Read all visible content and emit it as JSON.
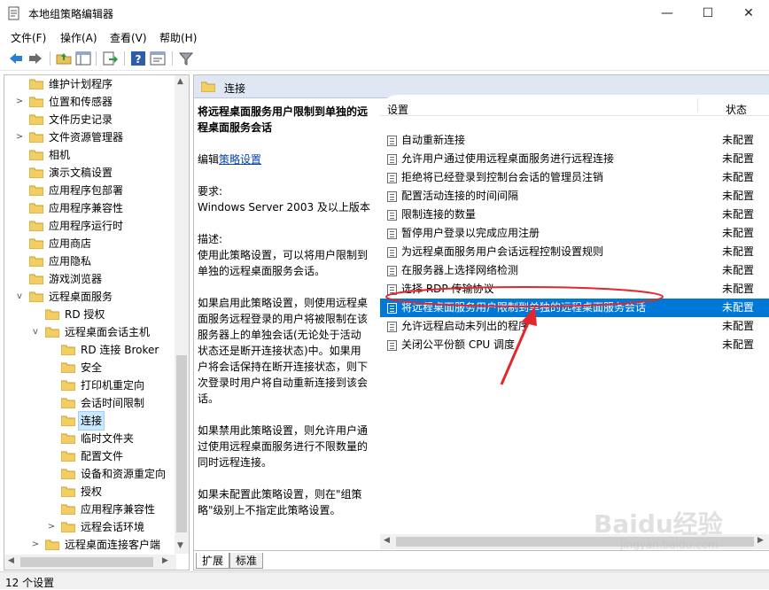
{
  "window": {
    "title": "本地组策略编辑器",
    "controls": {
      "minimize": "—",
      "maximize": "☐",
      "close": "✕"
    }
  },
  "menu": [
    "文件(F)",
    "操作(A)",
    "查看(V)",
    "帮助(H)"
  ],
  "toolbar_icons": [
    "back-icon",
    "forward-icon",
    "up-folder-icon",
    "show-hide-tree-icon",
    "export-icon",
    "help-icon",
    "properties-icon",
    "filter-icon"
  ],
  "tree": [
    {
      "label": "维护计划程序",
      "expander": ""
    },
    {
      "label": "位置和传感器",
      "expander": ">"
    },
    {
      "label": "文件历史记录",
      "expander": ""
    },
    {
      "label": "文件资源管理器",
      "expander": ">"
    },
    {
      "label": "相机",
      "expander": ""
    },
    {
      "label": "演示文稿设置",
      "expander": ""
    },
    {
      "label": "应用程序包部署",
      "expander": ""
    },
    {
      "label": "应用程序兼容性",
      "expander": ""
    },
    {
      "label": "应用程序运行时",
      "expander": ""
    },
    {
      "label": "应用商店",
      "expander": ""
    },
    {
      "label": "应用隐私",
      "expander": ""
    },
    {
      "label": "游戏浏览器",
      "expander": ""
    },
    {
      "label": "远程桌面服务",
      "expander": "v"
    },
    {
      "label": "RD 授权",
      "expander": ""
    },
    {
      "label": "远程桌面会话主机",
      "expander": "v"
    },
    {
      "label": "RD 连接 Broker",
      "expander": ""
    },
    {
      "label": "安全",
      "expander": ""
    },
    {
      "label": "打印机重定向",
      "expander": ""
    },
    {
      "label": "会话时间限制",
      "expander": ""
    },
    {
      "label": "连接",
      "expander": "",
      "selected": true
    },
    {
      "label": "临时文件夹",
      "expander": ""
    },
    {
      "label": "配置文件",
      "expander": ""
    },
    {
      "label": "设备和资源重定向",
      "expander": ""
    },
    {
      "label": "授权",
      "expander": ""
    },
    {
      "label": "应用程序兼容性",
      "expander": ""
    },
    {
      "label": "远程会话环境",
      "expander": ">"
    },
    {
      "label": "远程桌面连接客户端",
      "expander": ">"
    }
  ],
  "right": {
    "header_title": "连接",
    "description": {
      "title": "将远程桌面服务用户限制到单独的远程桌面服务会话",
      "edit_prefix": "编辑",
      "edit_link": "策略设置",
      "requirement_label": "要求:",
      "requirement_value": "Windows Server 2003 及以上版本",
      "desc_label": "描述:",
      "desc_p1": "使用此策略设置，可以将用户限制到单独的远程桌面服务会话。",
      "desc_p2": "如果启用此策略设置，则使用远程桌面服务远程登录的用户将被限制在该服务器上的单独会话(无论处于活动状态还是断开连接状态)中。如果用户将会话保持在断开连接状态，则下次登录时用户将自动重新连接到该会话。",
      "desc_p3": "如果禁用此策略设置，则允许用户通过使用远程桌面服务进行不限数量的同时远程连接。",
      "desc_p4": "如果未配置此策略设置，则在\"组策略\"级别上不指定此策略设置。"
    },
    "columns": {
      "setting": "设置",
      "state": "状态"
    },
    "rows": [
      {
        "name": "自动重新连接",
        "state": "未配置"
      },
      {
        "name": "允许用户通过使用远程桌面服务进行远程连接",
        "state": "未配置"
      },
      {
        "name": "拒绝将已经登录到控制台会话的管理员注销",
        "state": "未配置"
      },
      {
        "name": "配置活动连接的时间间隔",
        "state": "未配置"
      },
      {
        "name": "限制连接的数量",
        "state": "未配置"
      },
      {
        "name": "暂停用户登录以完成应用注册",
        "state": "未配置"
      },
      {
        "name": "为远程桌面服务用户会话远程控制设置规则",
        "state": "未配置"
      },
      {
        "name": "在服务器上选择网络检测",
        "state": "未配置"
      },
      {
        "name": "选择 RDP 传输协议",
        "state": "未配置"
      },
      {
        "name": "将远程桌面服务用户限制到单独的远程桌面服务会话",
        "state": "未配置",
        "selected": true
      },
      {
        "name": "允许远程启动未列出的程序",
        "state": "未配置"
      },
      {
        "name": "关闭公平份额 CPU 调度",
        "state": "未配置"
      }
    ],
    "tabs": [
      "扩展",
      "标准"
    ]
  },
  "status": "12 个设置",
  "watermark": {
    "text": "Baidu经验",
    "sub": "jingyan.baidu.com"
  },
  "colors": {
    "selection": "#0078d7",
    "annotation": "#e0282e",
    "header_bg": "#dfe7f4"
  }
}
